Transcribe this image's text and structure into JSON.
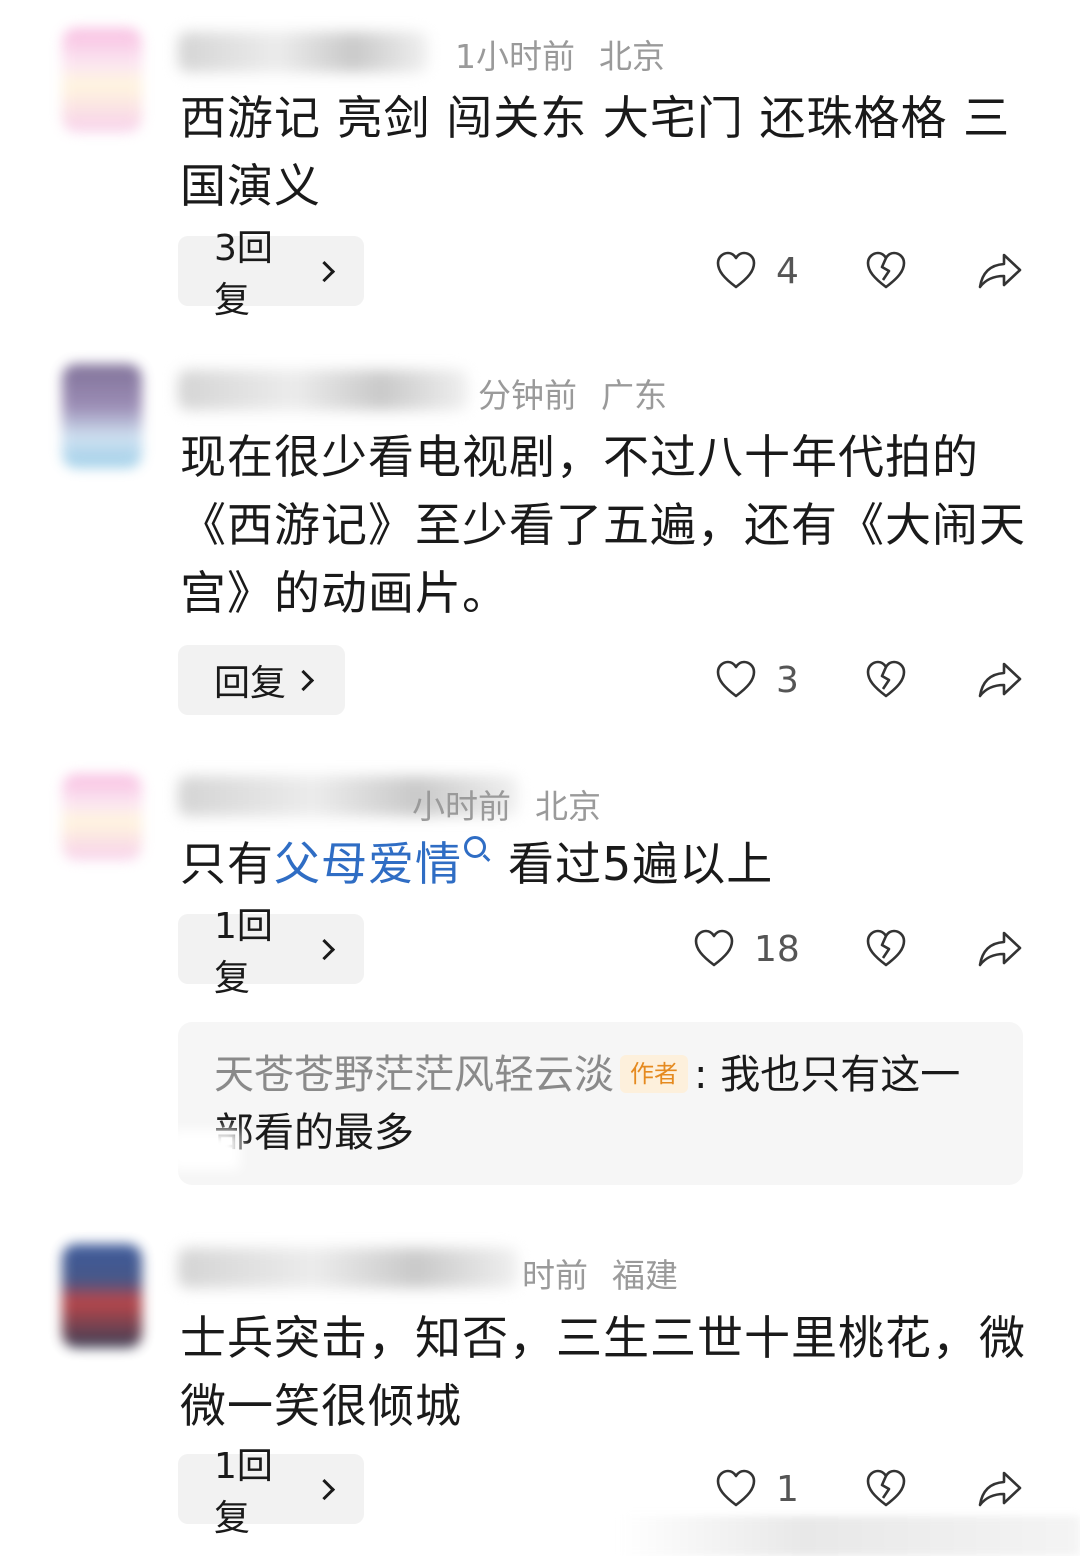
{
  "comments": [
    {
      "time": "1小时前",
      "location": "北京",
      "text": "西游记 亮剑 闯关东 大宅门 还珠格格 三国演义",
      "reply_label": "3回复",
      "likes": "4"
    },
    {
      "time": "分钟前",
      "location": "广东",
      "text": "现在很少看电视剧，不过八十年代拍的《西游记》至少看了五遍，还有《大闹天宫》的动画片。",
      "reply_label": "回复",
      "likes": "3"
    },
    {
      "time": "小时前",
      "location": "北京",
      "text_before": "只有",
      "link": "父母爱情",
      "text_after": "看过5遍以上",
      "reply_label": "1回复",
      "likes": "18",
      "sub_reply": {
        "author": "天苍苍野茫茫风轻云淡",
        "badge": "作者",
        "text": ": 我也只有这一部看的最多"
      }
    },
    {
      "time": "时前",
      "location": "福建",
      "text": "士兵突击，知否，三生三世十里桃花，微微一笑很倾城",
      "reply_label": "1回复",
      "likes": "1"
    }
  ],
  "icons": {
    "like": "heart-outline-icon",
    "dislike": "broken-heart-icon",
    "share": "share-arrow-icon",
    "search_link": "search-icon"
  }
}
